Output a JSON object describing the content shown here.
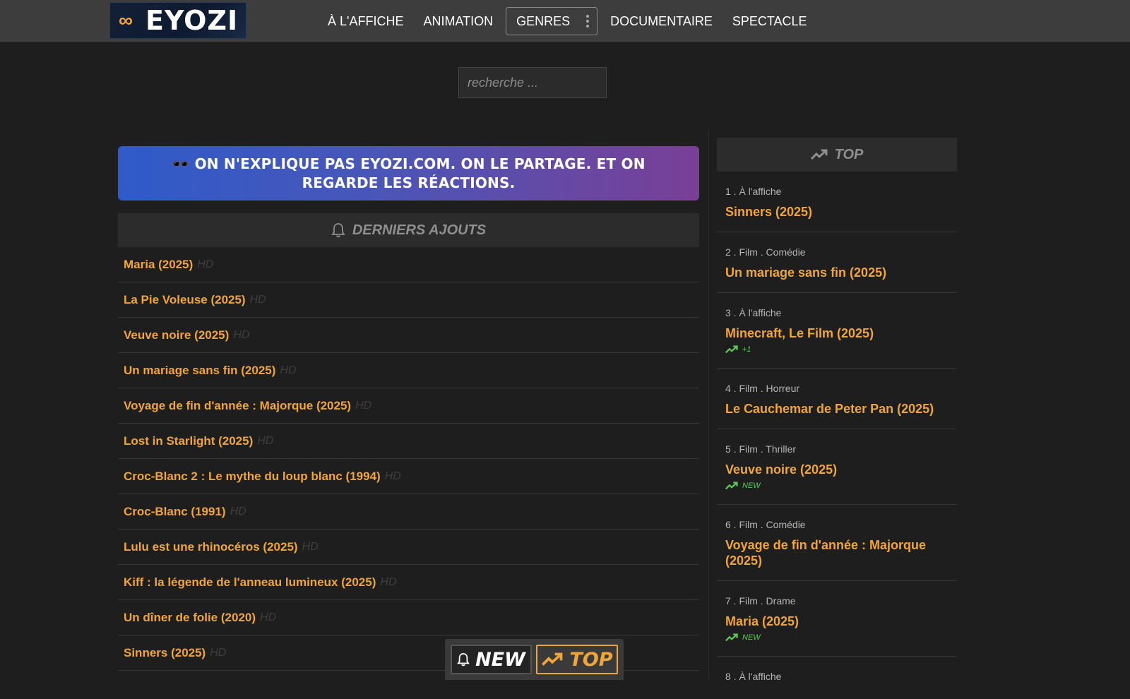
{
  "site": {
    "logo_glyph": "∞",
    "logo_text": "EYOZI"
  },
  "nav": {
    "items": [
      {
        "label": "À L'AFFICHE"
      },
      {
        "label": "ANIMATION"
      },
      {
        "label": "GENRES"
      },
      {
        "label": "DOCUMENTAIRE"
      },
      {
        "label": "SPECTACLE"
      }
    ]
  },
  "search": {
    "placeholder": "recherche ..."
  },
  "banner": {
    "text": "🕶️ ON N'EXPLIQUE PAS EYOZI.COM. ON LE PARTAGE. ET ON REGARDE LES RÉACTIONS."
  },
  "latest": {
    "title": "DERNIERS AJOUTS",
    "icon": "bell-icon",
    "items": [
      {
        "title": "Maria (2025)",
        "quality": "HD"
      },
      {
        "title": "La Pie Voleuse (2025)",
        "quality": "HD"
      },
      {
        "title": "Veuve noire (2025)",
        "quality": "HD"
      },
      {
        "title": "Un mariage sans fin (2025)",
        "quality": "HD"
      },
      {
        "title": "Voyage de fin d'année : Majorque (2025)",
        "quality": "HD"
      },
      {
        "title": "Lost in Starlight (2025)",
        "quality": "HD"
      },
      {
        "title": "Croc-Blanc 2 : Le mythe du loup blanc (1994)",
        "quality": "HD"
      },
      {
        "title": "Croc-Blanc (1991)",
        "quality": "HD"
      },
      {
        "title": "Lulu est une rhinocéros (2025)",
        "quality": "HD"
      },
      {
        "title": "Kiff : la légende de l'anneau lumineux (2025)",
        "quality": "HD"
      },
      {
        "title": "Un dîner de folie (2020)",
        "quality": "HD"
      },
      {
        "title": "Sinners (2025)",
        "quality": "HD"
      }
    ]
  },
  "top": {
    "title": "TOP",
    "icon": "trending-up-icon",
    "items": [
      {
        "meta": "1 . À l'affiche",
        "title": "Sinners (2025)",
        "trend": ""
      },
      {
        "meta": "2 . Film . Comédie",
        "title": "Un mariage sans fin (2025)",
        "trend": ""
      },
      {
        "meta": "3 . À l'affiche",
        "title": "Minecraft, Le Film (2025)",
        "trend": "+1"
      },
      {
        "meta": "4 . Film . Horreur",
        "title": "Le Cauchemar de Peter Pan (2025)",
        "trend": ""
      },
      {
        "meta": "5 . Film . Thriller",
        "title": "Veuve noire (2025)",
        "trend": "NEW"
      },
      {
        "meta": "6 . Film . Comédie",
        "title": "Voyage de fin d'année : Majorque (2025)",
        "trend": ""
      },
      {
        "meta": "7 . Film . Drame",
        "title": "Maria (2025)",
        "trend": "NEW"
      },
      {
        "meta": "8 . À l'affiche",
        "title": "",
        "trend": ""
      }
    ]
  },
  "bottom_bar": {
    "new_label": "NEW",
    "top_label": "TOP"
  },
  "colors": {
    "accent": "#f0a53a",
    "trend_green": "#5cc95a",
    "background": "#1e1e1e"
  }
}
